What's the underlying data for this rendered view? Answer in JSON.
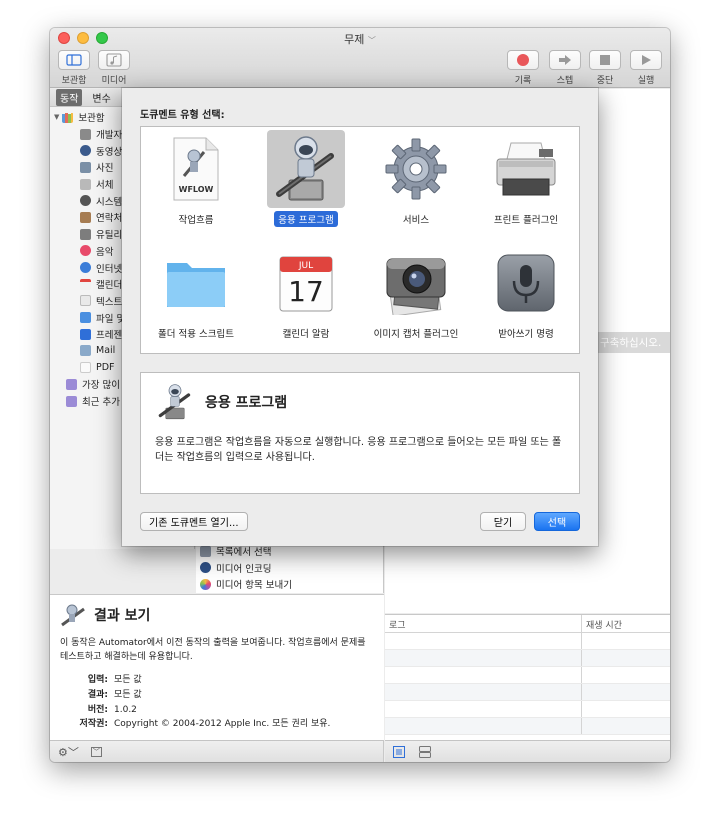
{
  "window": {
    "title": "무제",
    "toolbar": {
      "library_label": "보관함",
      "media_label": "미디어",
      "record_label": "기록",
      "step_label": "스텝",
      "stop_label": "중단",
      "run_label": "실행"
    }
  },
  "library": {
    "tabs": [
      "동작",
      "변수"
    ],
    "root_label": "보관함",
    "items": [
      {
        "label": "개발자",
        "icon": "developer-icon"
      },
      {
        "label": "동영상",
        "icon": "movies-icon"
      },
      {
        "label": "사진",
        "icon": "photos-icon"
      },
      {
        "label": "서체",
        "icon": "fonts-icon"
      },
      {
        "label": "시스템",
        "icon": "system-icon"
      },
      {
        "label": "연락처",
        "icon": "contacts-icon"
      },
      {
        "label": "유틸리",
        "icon": "utilities-icon"
      },
      {
        "label": "음악",
        "icon": "music-icon"
      },
      {
        "label": "인터넷",
        "icon": "internet-icon"
      },
      {
        "label": "캘린더",
        "icon": "calendar-icon"
      },
      {
        "label": "텍스트",
        "icon": "text-icon"
      },
      {
        "label": "파일 및",
        "icon": "files-icon"
      },
      {
        "label": "프레젠",
        "icon": "presentations-icon"
      },
      {
        "label": "Mail",
        "icon": "mail-icon"
      },
      {
        "label": "PDF",
        "icon": "pdf-icon"
      }
    ],
    "smart_groups": [
      {
        "label": "가장 많이",
        "icon": "smart-folder-icon"
      },
      {
        "label": "최근 추가",
        "icon": "smart-folder-icon"
      }
    ]
  },
  "actions": [
    {
      "label": "목록에서 선택"
    },
    {
      "label": "미디어 인코딩"
    },
    {
      "label": "미디어 항목 보내기"
    }
  ],
  "description": {
    "title": "결과 보기",
    "text": "이 동작은 Automator에서 이전 동작의 출력을 보여줍니다. 작업흐름에서 문제를 테스트하고 해결하는데 유용합니다.",
    "meta": [
      {
        "key": "입력:",
        "value": "모든 값"
      },
      {
        "key": "결과:",
        "value": "모든 값"
      },
      {
        "key": "버전:",
        "value": "1.0.2"
      },
      {
        "key": "저작권:",
        "value": "Copyright © 2004-2012 Apple Inc.  모든 권리 보유."
      }
    ]
  },
  "workflow": {
    "hint": "을 구축하십시오."
  },
  "log": {
    "col1": "로그",
    "col2": "재생 시간"
  },
  "sheet": {
    "title": "도큐멘트 유형 선택:",
    "types": [
      {
        "label": "작업흐름",
        "icon": "workflow-file-icon",
        "selected": false,
        "file_badge": "WFLOW"
      },
      {
        "label": "응용 프로그램",
        "icon": "automator-robot-icon",
        "selected": true
      },
      {
        "label": "서비스",
        "icon": "gear-icon",
        "selected": false
      },
      {
        "label": "프린트 플러그인",
        "icon": "printer-icon",
        "selected": false
      },
      {
        "label": "폴더 적용 스크립트",
        "icon": "folder-icon",
        "selected": false
      },
      {
        "label": "캘린더 알람",
        "icon": "calendar-icon",
        "selected": false,
        "cal_month": "JUL",
        "cal_day": "17"
      },
      {
        "label": "이미지 캡처 플러그인",
        "icon": "camera-icon",
        "selected": false
      },
      {
        "label": "받아쓰기 명령",
        "icon": "microphone-icon",
        "selected": false
      }
    ],
    "detail_title": "응용 프로그램",
    "detail_text": "응용 프로그램은 작업흐름을 자동으로 실행합니다. 응용 프로그램으로 들어오는 모든 파일 또는 폴더는 작업흐름의 입력으로 사용됩니다.",
    "open_existing": "기존 도큐멘트 열기...",
    "close": "닫기",
    "choose": "선택"
  },
  "colors": {
    "accent": "#2c6bd8",
    "primary_button": "#1a73f0"
  }
}
